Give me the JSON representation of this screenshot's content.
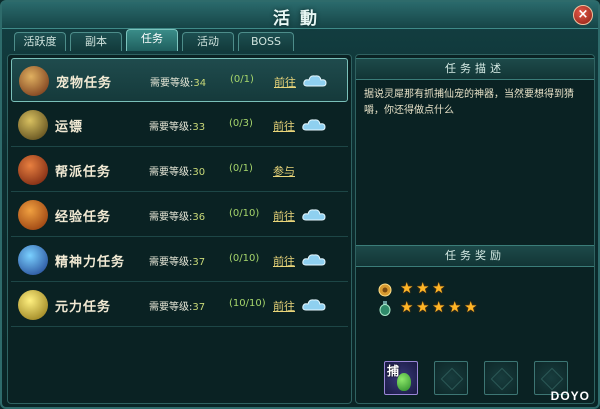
{
  "window": {
    "title": "活動",
    "close_label": "×"
  },
  "tabs": [
    {
      "label": "活跃度",
      "active": false
    },
    {
      "label": "副本",
      "active": false
    },
    {
      "label": "任务",
      "active": true
    },
    {
      "label": "活动",
      "active": false
    },
    {
      "label": "BOSS",
      "active": false
    }
  ],
  "tasks": [
    {
      "name": "宠物任务",
      "req_label": "需要等级:",
      "level": "34",
      "progress": "(0/1)",
      "action": "前往",
      "icon": "pet-icon",
      "selected": true
    },
    {
      "name": "运镖",
      "req_label": "需要等级:",
      "level": "33",
      "progress": "(0/3)",
      "action": "前往",
      "icon": "escort-icon",
      "selected": false
    },
    {
      "name": "帮派任务",
      "req_label": "需要等级:",
      "level": "30",
      "progress": "(0/1)",
      "action": "参与",
      "icon": "guild-icon",
      "selected": false
    },
    {
      "name": "经验任务",
      "req_label": "需要等级:",
      "level": "36",
      "progress": "(0/10)",
      "action": "前往",
      "icon": "exp-icon",
      "selected": false
    },
    {
      "name": "精神力任务",
      "req_label": "需要等级:",
      "level": "37",
      "progress": "(0/10)",
      "action": "前往",
      "icon": "spirit-icon",
      "selected": false
    },
    {
      "name": "元力任务",
      "req_label": "需要等级:",
      "level": "37",
      "progress": "(10/10)",
      "action": "前往",
      "icon": "yuanli-icon",
      "selected": false
    }
  ],
  "description": {
    "header": "任务描述",
    "text": "据说灵犀那有抓捕仙宠的神器，当然要想得到猜嚼，你还得做点什么"
  },
  "rewards": {
    "header": "任务奖励",
    "lines": [
      {
        "icon": "coin-icon",
        "stars": 3
      },
      {
        "icon": "potion-icon",
        "stars": 5
      }
    ],
    "slots": [
      {
        "filled": true,
        "char": "捕",
        "icon": "gourd-icon"
      },
      {
        "filled": false
      },
      {
        "filled": false
      },
      {
        "filled": false
      }
    ]
  },
  "watermark": "DOYO",
  "colors": {
    "accent": "#7ac0b9",
    "star": "#ffb526",
    "level_text": "#c8d878",
    "progress_text": "#a6d66c",
    "action_link": "#e9d57a"
  }
}
